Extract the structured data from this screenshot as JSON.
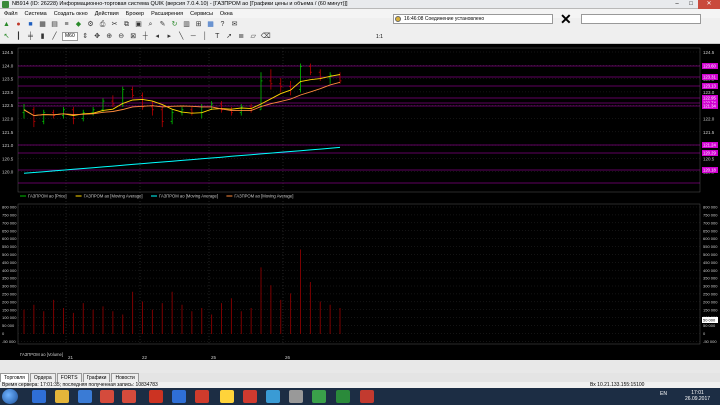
{
  "window": {
    "title": "NB914 (ID: 26228) Информационно-торговая система QUIK (версия 7.0.4.10) - [ГАЗПРОМ ао [Графики цены и объема / (60 минут)]]",
    "min": "–",
    "max": "□",
    "close": "✕"
  },
  "menu": [
    "Файл",
    "Система",
    "Создать окно",
    "Действия",
    "Брокер",
    "Расширения",
    "Сервисы",
    "Окна"
  ],
  "toolbar": {
    "timeframe": "M60",
    "ratio": "1:1",
    "status_text": "16:46:08 Соединение установлено"
  },
  "price_axis": {
    "ticks": [
      "124.5",
      "124.0",
      "123.5",
      "123.0",
      "122.5",
      "122.0",
      "121.5",
      "121.0",
      "120.5",
      "120.0"
    ],
    "right_labels": [
      "123.60",
      "123.31",
      "123.13",
      "122.95",
      "122.74",
      "121.34",
      "121.24",
      "120.29",
      "120.18"
    ]
  },
  "price_legend": [
    {
      "label": "ГАЗПРОМ ао [Price]",
      "color": "#00c000"
    },
    {
      "label": "ГАЗПРОМ ао [Moving Average]",
      "color": "#ffd700"
    },
    {
      "label": "ГАЗПРОМ ао [Moving Average]",
      "color": "#00ffff"
    },
    {
      "label": "ГАЗПРОМ ао [Moving Average]",
      "color": "#ff8a3d"
    }
  ],
  "volume_axis": {
    "ticks": [
      "800 000",
      "750 000",
      "700 000",
      "650 000",
      "600 000",
      "550 000",
      "500 000",
      "450 000",
      "400 000",
      "350 000",
      "300 000",
      "250 000",
      "200 000",
      "150 000",
      "100 000",
      "50 000",
      "0",
      "-50 000"
    ],
    "right_label": "50 000"
  },
  "volume_legend": "ГАЗПРОМ ао [Volume]",
  "date_labels": [
    "21",
    "22",
    "25",
    "26"
  ],
  "tabs": [
    {
      "label": "Торговля",
      "active": true
    },
    {
      "label": "Ордера",
      "active": false
    },
    {
      "label": "FORTS",
      "active": false
    },
    {
      "label": "Графики",
      "active": false
    },
    {
      "label": "Новости",
      "active": false
    }
  ],
  "statusbar": {
    "left": "Время сервера: 17:01:35; последняя полученная запись: 10834783",
    "right": "Вх 10.21.133.155:15100"
  },
  "taskbar": {
    "lang": "EN",
    "time": "17:01",
    "date": "26.09.2017"
  },
  "colors": {
    "bg": "#000000",
    "grid_magenta": "#c000c0",
    "bull": "#00c000",
    "bear": "#c00000",
    "ma_fast": "#ffd700",
    "ma_slow": "#ff8a3d",
    "ma_long": "#00ffff",
    "volume_bar": "#8b0000",
    "label_bg": "#d000d0"
  }
}
